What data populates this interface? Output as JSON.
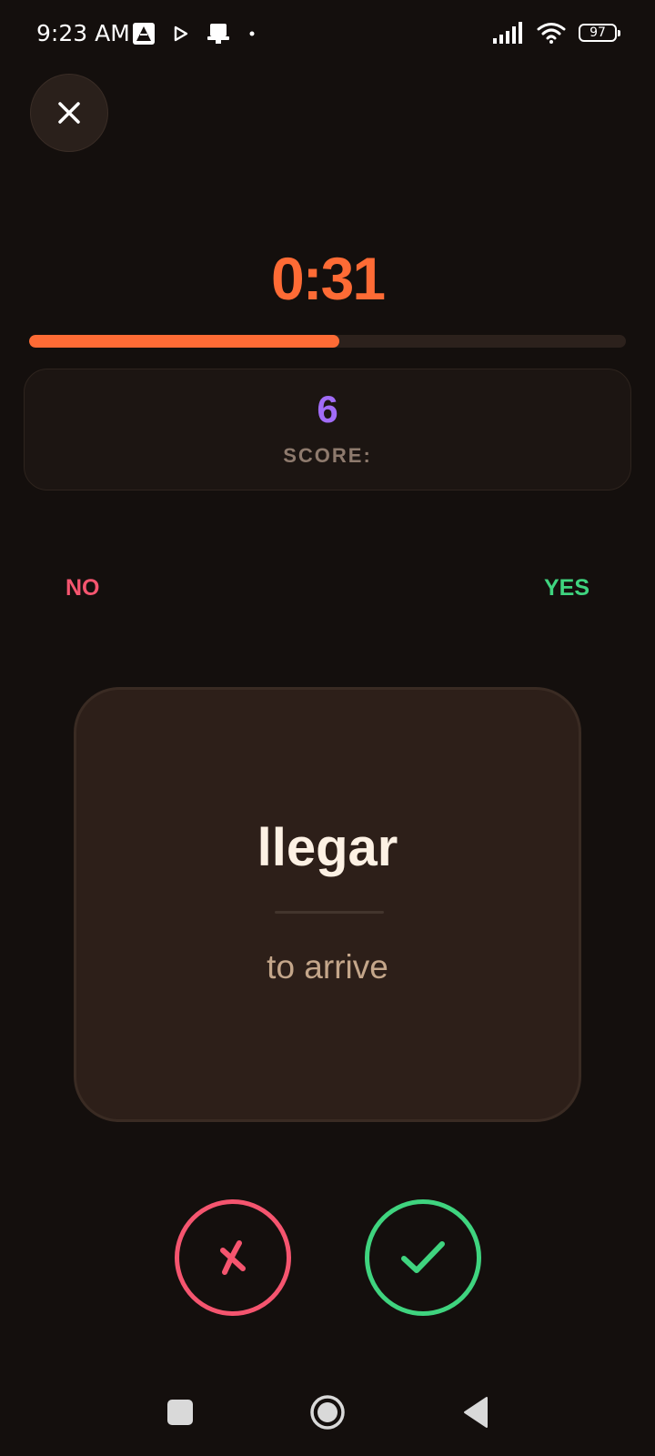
{
  "status_bar": {
    "time": "9:23 AM",
    "battery_level": "97"
  },
  "game": {
    "timer": "0:31",
    "progress_fraction": 0.52,
    "score_value": "6",
    "score_label": "SCORE:",
    "hint_no": "NO",
    "hint_yes": "YES"
  },
  "card": {
    "word": "llegar",
    "translation": "to arrive"
  },
  "buttons": {
    "no_symbol": "✗"
  },
  "icons": {
    "close": "close-icon",
    "wrong": "cross-mark-icon",
    "right": "checkmark-icon"
  },
  "colors": {
    "accent": "#fe6b35",
    "score": "#a16cf7",
    "no": "#f5556f",
    "yes": "#3fd47f",
    "background": "#140f0d",
    "card": "#2d1f19"
  }
}
